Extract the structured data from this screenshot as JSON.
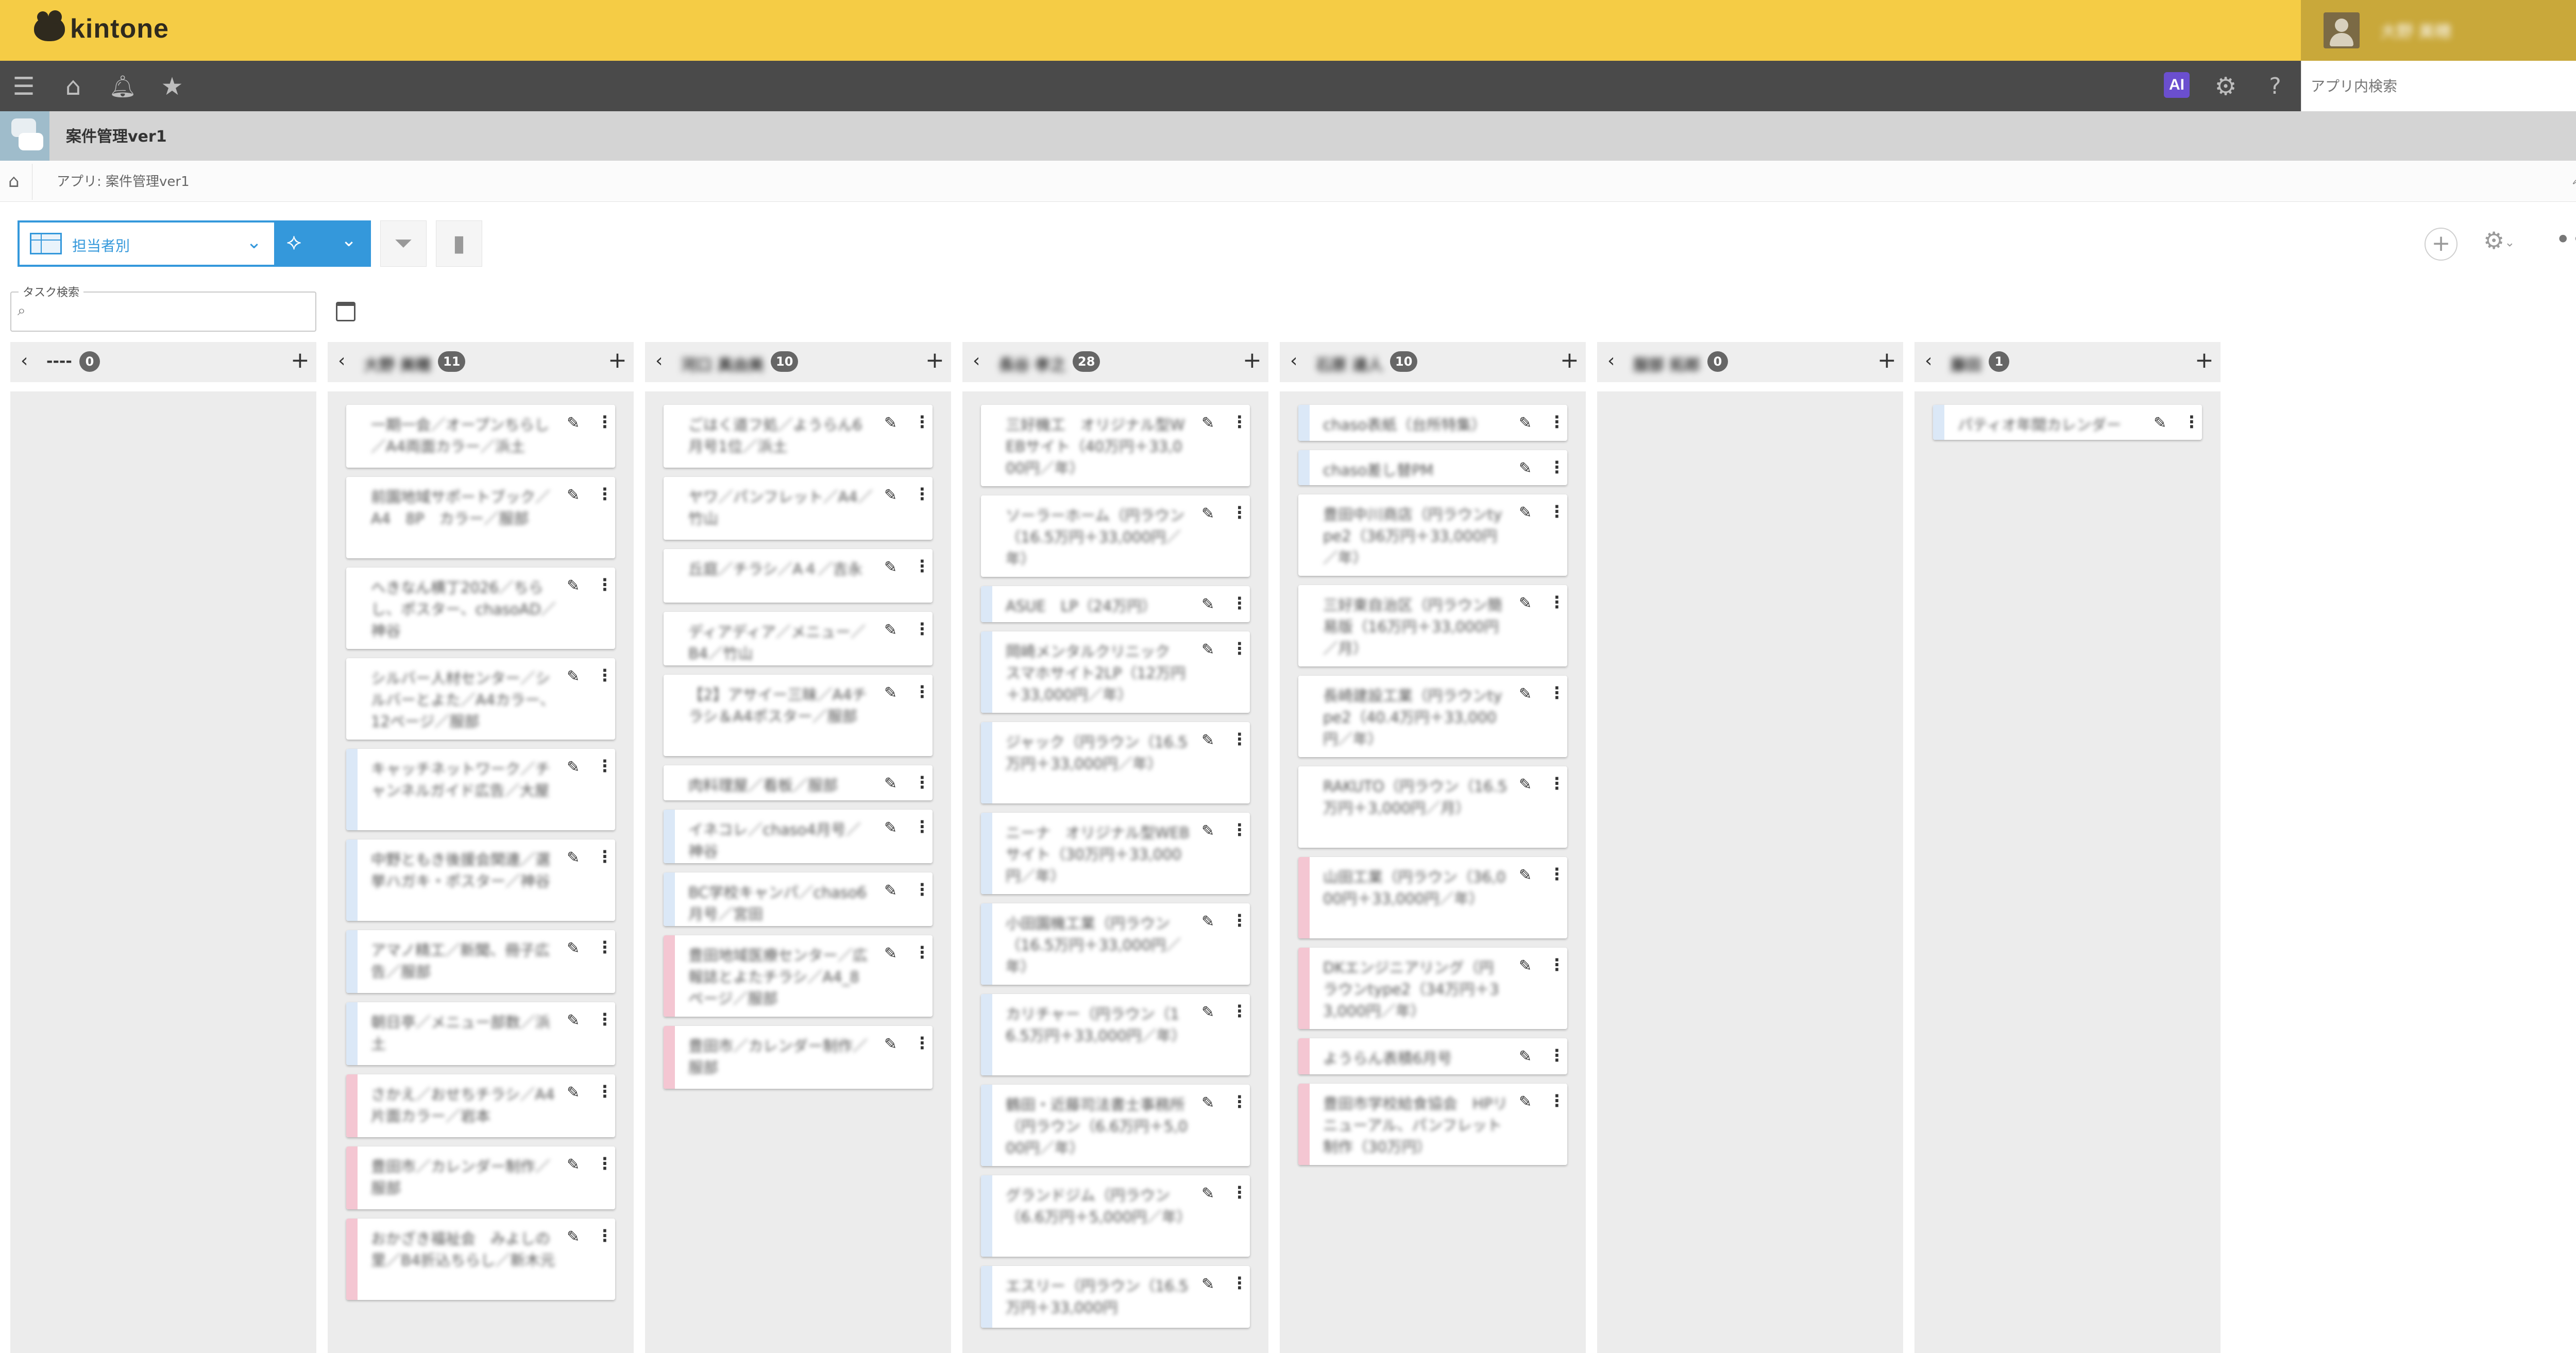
{
  "header": {
    "logo_text": "kintone",
    "user_name": "大野 美穂"
  },
  "nav": {
    "ai_label": "AI",
    "search_placeholder": "アプリ内検索"
  },
  "app": {
    "title": "案件管理ver1"
  },
  "breadcrumb": {
    "text": "アプリ: 案件管理ver1"
  },
  "toolbar": {
    "view_label": "担当者別"
  },
  "task_search": {
    "label": "タスク検索"
  },
  "colors": {
    "accent": "#3498db",
    "header_yellow": "#f5cc45",
    "stripe_blue": "#dbe8f7",
    "stripe_pink": "#f4c6d2"
  },
  "columns": [
    {
      "name": "----",
      "count": "0",
      "cards": []
    },
    {
      "name": "大野 美穂",
      "count": "11",
      "cards": [
        {
          "text": "一期一会／オープンちらし／A4両面カラー／浜土",
          "color": "none"
        },
        {
          "text": "前園地域サポートブック／A4　8P　カラー／服部",
          "color": "none"
        },
        {
          "text": "へきなん横丁2026／ちらし、ポスター、chasoAD／神谷",
          "color": "none"
        },
        {
          "text": "シルバー人材センター／シルバーとよた／A4カラー、12ページ／服部",
          "color": "none"
        },
        {
          "text": "キャッチネットワーク／チャンネルガイド広告／大屋",
          "color": "blue"
        },
        {
          "text": "中野ともき後援会関連／選挙ハガキ・ポスター／神谷",
          "color": "blue"
        },
        {
          "text": "アマノ精工／新聞、冊子広告／服部",
          "color": "blue"
        },
        {
          "text": "朝日亭／メニュー部数／浜土",
          "color": "blue"
        },
        {
          "text": "さかえ／おせちチラシ／A4片面カラー／岩本",
          "color": "pink"
        },
        {
          "text": "豊田市／カレンダー制作／服部",
          "color": "pink"
        },
        {
          "text": "おかざき福祉会　みよしの里／B4折込ちらし／新木元",
          "color": "pink"
        }
      ]
    },
    {
      "name": "河口 真由美",
      "count": "10",
      "cards": [
        {
          "text": "ごはく道フ処／ようらん6月号1位／浜土",
          "color": "none"
        },
        {
          "text": "ヤワ／パンフレット／A4／竹山",
          "color": "none"
        },
        {
          "text": "丘庭／チラシ／A４／吉永",
          "color": "none"
        },
        {
          "text": "ディアディア／メニュー／B4／竹山",
          "color": "none"
        },
        {
          "text": "【2】アサイー三昧／A4チラシ＆A4ポスター／服部",
          "color": "none"
        },
        {
          "text": "肉料理屋／看板／服部",
          "color": "none"
        },
        {
          "text": "イネコレ／chaso4月号／神谷",
          "color": "blue"
        },
        {
          "text": "BC学校キャンパ／chaso6月号／宮田",
          "color": "blue"
        },
        {
          "text": "豊田地域医療センター／広報誌とよたチラシ／A4_8ページ／服部",
          "color": "pink"
        },
        {
          "text": "豊田市／カレンダー制作／服部",
          "color": "pink"
        }
      ]
    },
    {
      "name": "長谷 孝之",
      "count": "28",
      "cards": [
        {
          "text": "三好機工　オリジナル型WEBサイト（40万円＋33,000円／年）",
          "color": "none"
        },
        {
          "text": "ソーラーホーム（円ラウン（16.5万円＋33,000円／年）",
          "color": "none"
        },
        {
          "text": "ASUE　LP（24万円）",
          "color": "blue"
        },
        {
          "text": "岡崎メンタルクリニック　スマホサイト2LP（12万円＋33,000円／年）",
          "color": "blue"
        },
        {
          "text": "ジャック（円ラウン（16.5万円＋33,000円／年）",
          "color": "blue"
        },
        {
          "text": "ニーナ　オリジナル型WEBサイト（30万円＋33,000円／年）",
          "color": "blue"
        },
        {
          "text": "小田園機工業（円ラウン（16.5万円＋33,000円／年）",
          "color": "blue"
        },
        {
          "text": "カリチャー（円ラウン（16.5万円＋33,000円／年）",
          "color": "blue"
        },
        {
          "text": "鶴田・近藤司法書士事務所（円ラウン（6.6万円＋5,000円／年）",
          "color": "blue"
        },
        {
          "text": "グランドジム（円ラウン（6.6万円＋5,000円／年）",
          "color": "blue"
        },
        {
          "text": "エスリー（円ラウン（16.5万円＋33,000円",
          "color": "blue"
        }
      ]
    },
    {
      "name": "石原 達人",
      "count": "10",
      "cards": [
        {
          "text": "chaso表紙（台所特集）",
          "color": "blue"
        },
        {
          "text": "chaso差し替PM",
          "color": "blue"
        },
        {
          "text": "豊田中川商店（円ラウンtype2（36万円＋33,000円／年）",
          "color": "none"
        },
        {
          "text": "三好東自治区（円ラウン簡易版（16万円＋33,000円／月）",
          "color": "none"
        },
        {
          "text": "長崎建設工業（円ラウンtype2（40.4万円＋33,000円／年）",
          "color": "none"
        },
        {
          "text": "RAKUTO（円ラウン（16.5万円＋3,000円／月）",
          "color": "none"
        },
        {
          "text": "山田工業（円ラウン（36,000円＋33,000円／年）",
          "color": "pink"
        },
        {
          "text": "DKエンジニアリング（円ラウンtype2（34万円＋33,000円／年）",
          "color": "pink"
        },
        {
          "text": "ようらん表積6月号",
          "color": "pink"
        },
        {
          "text": "豊田市学校給食協会　HPリニューアル、パンフレット制作（30万円）",
          "color": "pink"
        }
      ]
    },
    {
      "name": "服部 拓郎",
      "count": "0",
      "cards": []
    },
    {
      "name": "藤田",
      "count": "1",
      "cards": [
        {
          "text": "パティオ年間カレンダー",
          "color": "blue"
        }
      ]
    }
  ]
}
